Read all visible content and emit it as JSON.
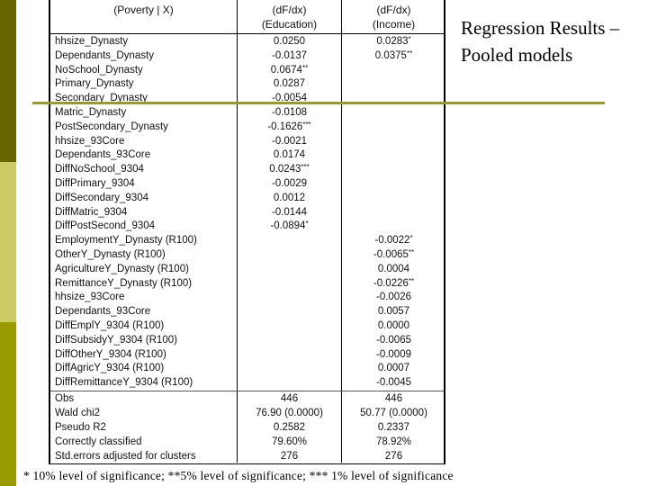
{
  "slide": {
    "title_line1": "Regression Results –",
    "title_line2": "Pooled models",
    "footnote": "* 10% level of significance; **5% level of significance; *** 1% level of significance",
    "colors": {
      "bar_dark": "#666600",
      "bar_light": "#cccc66",
      "bar_mid": "#999900",
      "rule": "#999933"
    }
  },
  "table": {
    "header": {
      "label": "(Poverty | X)",
      "col1_line1": "(dF/dx)",
      "col1_line2": "(Education)",
      "col2_line1": "(dF/dx)",
      "col2_line2": "(Income)"
    },
    "rows": [
      {
        "label": "hhsize_Dynasty",
        "education": "0.0250",
        "income": "0.0283*"
      },
      {
        "label": "Dependants_Dynasty",
        "education": "-0.0137",
        "income": "0.0375**"
      },
      {
        "label": "NoSchool_Dynasty",
        "education": "0.0674**",
        "income": ""
      },
      {
        "label": "Primary_Dynasty",
        "education": "0.0287",
        "income": ""
      },
      {
        "label": "Secondary_Dynasty",
        "education": "-0.0054",
        "income": ""
      },
      {
        "label": "Matric_Dynasty",
        "education": "-0.0108",
        "income": ""
      },
      {
        "label": "PostSecondary_Dynasty",
        "education": "-0.1626***",
        "income": ""
      },
      {
        "label": "hhsize_93Core",
        "education": "-0.0021",
        "income": ""
      },
      {
        "label": "Dependants_93Core",
        "education": "0.0174",
        "income": ""
      },
      {
        "label": "DiffNoSchool_9304",
        "education": "0.0243***",
        "income": ""
      },
      {
        "label": "DiffPrimary_9304",
        "education": "-0.0029",
        "income": ""
      },
      {
        "label": "DiffSecondary_9304",
        "education": "0.0012",
        "income": ""
      },
      {
        "label": "DiffMatric_9304",
        "education": "-0.0144",
        "income": ""
      },
      {
        "label": "DiffPostSecond_9304",
        "education": "-0.0894*",
        "income": ""
      },
      {
        "label": "EmploymentY_Dynasty (R100)",
        "education": "",
        "income": "-0.0022*"
      },
      {
        "label": "OtherY_Dynasty (R100)",
        "education": "",
        "income": "-0.0065**"
      },
      {
        "label": "AgricultureY_Dynasty (R100)",
        "education": "",
        "income": "0.0004"
      },
      {
        "label": "RemittanceY_Dynasty (R100)",
        "education": "",
        "income": "-0.0226**"
      },
      {
        "label": "hhsize_93Core",
        "education": "",
        "income": "-0.0026"
      },
      {
        "label": "Dependants_93Core",
        "education": "",
        "income": "0.0057"
      },
      {
        "label": "DiffEmplY_9304 (R100)",
        "education": "",
        "income": "0.0000"
      },
      {
        "label": "DiffSubsidyY_9304 (R100)",
        "education": "",
        "income": "-0.0065"
      },
      {
        "label": "DiffOtherY_9304 (R100)",
        "education": "",
        "income": "-0.0009"
      },
      {
        "label": "DiffAgricY_9304 (R100)",
        "education": "",
        "income": "0.0007"
      },
      {
        "label": "DiffRemittanceY_9304 (R100)",
        "education": "",
        "income": "-0.0045"
      }
    ],
    "stats": [
      {
        "label": "Obs",
        "education": "446",
        "income": "446"
      },
      {
        "label": "Wald chi2",
        "education": "76.90 (0.0000)",
        "income": "50.77 (0.0000)"
      },
      {
        "label": "Pseudo R2",
        "education": "0.2582",
        "income": "0.2337"
      },
      {
        "label": "Correctly classified",
        "education": "79.60%",
        "income": "78.92%"
      },
      {
        "label": "Std.errors adjusted for clusters",
        "education": "276",
        "income": "276"
      }
    ]
  }
}
